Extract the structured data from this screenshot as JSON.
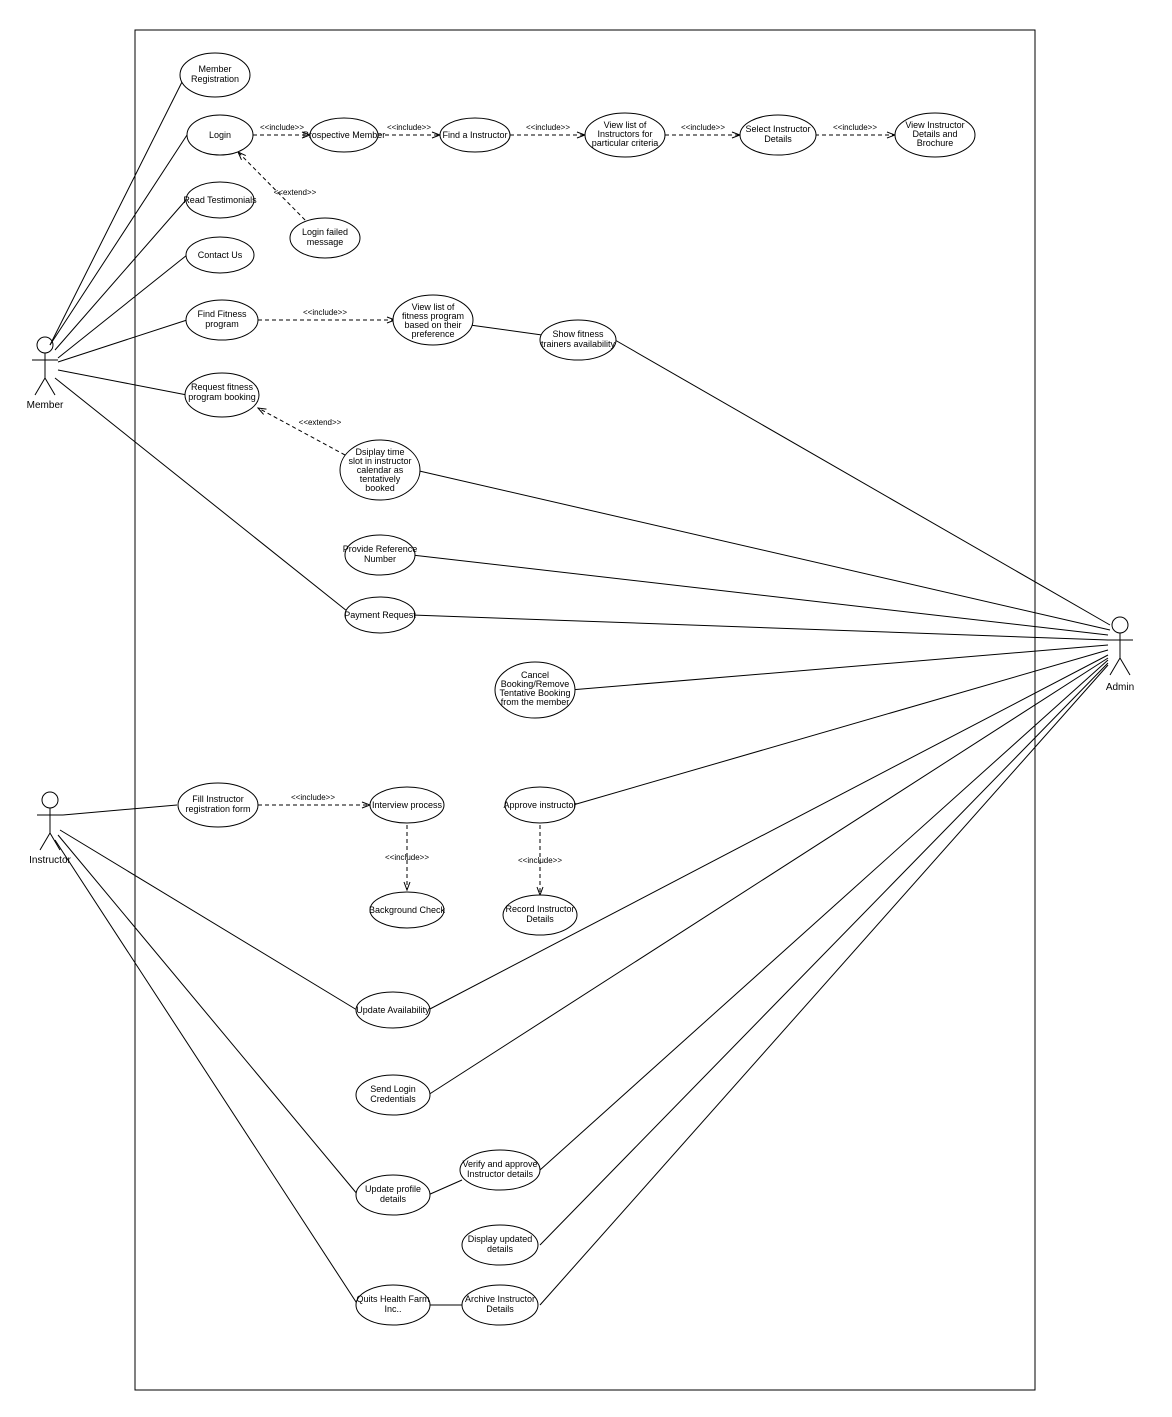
{
  "actors": {
    "member": "Member",
    "instructor": "Instructor",
    "admin": "Admin"
  },
  "usecases": {
    "memberReg": "Member Registration",
    "login": "Login",
    "prospective": "Prospective Member",
    "findInstructor": "Find a Instructor",
    "viewListInstr": "View list of Instructors for particular criteria",
    "selectInstr": "Select Instructor Details",
    "viewInstrDetails": "View Instructor Details and Brochure",
    "loginFailed": "Login  failed message",
    "readTest": "Read Testimonials",
    "contactUs": "Contact Us",
    "findFitness": "Find Fitness program",
    "viewListFitness": "View list of fitness program based on their preference",
    "showTrainers": "Show  fitness trainers availability",
    "requestBooking": "Request fitness program booking",
    "displayTimeSlot": "Dsiplay time slot in instructor calendar as tentatively booked",
    "provideRef": "Provide Reference Number",
    "paymentReq": "Payment Request",
    "cancelBooking": "Cancel Booking/Remove Tentative Booking from the member",
    "fillInstrForm": "Fill Instructor registration form",
    "interview": "Interview process",
    "approveInstr": "Approve instructor",
    "bgCheck": "Background Check",
    "recordInstr": "Record Instructor Details",
    "updateAvail": "Update Availability",
    "sendLogin": "Send Login Credentials",
    "updateProfile": "Update profile details",
    "verifyApprove": "Verify and approve Instructor  details",
    "displayUpdated": "Display updated details",
    "quits": "Quits Health Farm Inc..",
    "archive": "Archive Instructor Details"
  },
  "stereotypes": {
    "include": "<<include>>",
    "extend": "<<extend>>"
  }
}
